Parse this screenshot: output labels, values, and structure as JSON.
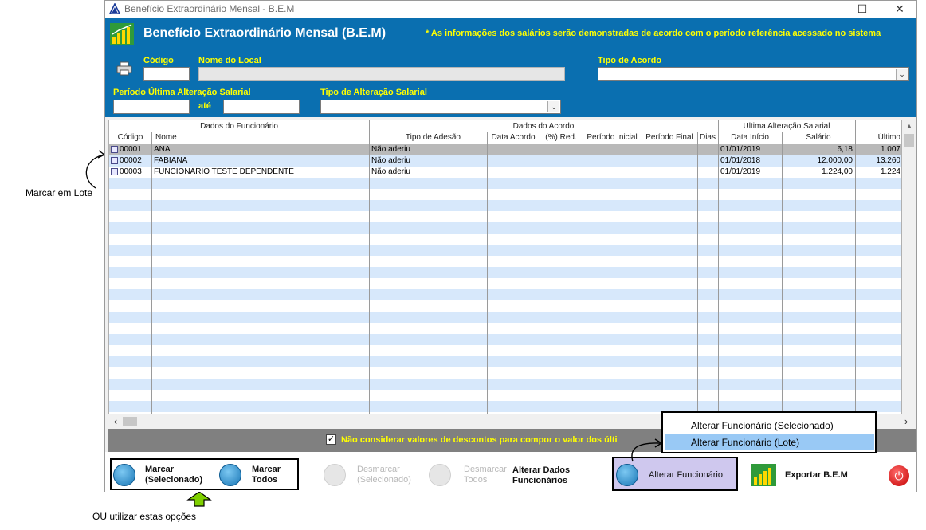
{
  "window": {
    "title": "Benefício Extraordinário Mensal - B.E.M",
    "minimize": "—",
    "maximize": "☐",
    "close": "✕"
  },
  "banner": {
    "title": "Benefício Extraordinário Mensal (B.E.M)",
    "note": "* As informações dos salários serão demonstradas de acordo com o período referência acessado no sistema"
  },
  "filters": {
    "codigo_label": "Código",
    "nome_local_label": "Nome do Local",
    "tipo_acordo_label": "Tipo de Acordo",
    "periodo_label": "Período Última Alteração Salarial",
    "ate_label": "até",
    "tipo_alteracao_label": "Tipo de Alteração Salarial",
    "codigo_value": "",
    "nome_local_value": "",
    "tipo_acordo_value": "",
    "periodo_inicio_value": "",
    "periodo_fim_value": "",
    "tipo_alteracao_value": ""
  },
  "grid": {
    "groups": {
      "funcionario": "Dados do Funcionário",
      "acordo": "Dados do Acordo",
      "ultima": "Ultima Alteração Salarial"
    },
    "columns": [
      "Código",
      "Nome",
      "Tipo de Adesão",
      "Data Acordo",
      "(%) Red.",
      "Período Inicial",
      "Período Final",
      "Dias",
      "Data Início",
      "Salário",
      "Último"
    ],
    "rows": [
      {
        "codigo": "00001",
        "nome": "ANA",
        "adesao": "Não aderiu",
        "data_acordo": "",
        "red": "",
        "p_ini": "",
        "p_fim": "",
        "dias": "",
        "data_inicio": "01/01/2019",
        "salario": "6,18",
        "ultimo": "1.007"
      },
      {
        "codigo": "00002",
        "nome": "FABIANA",
        "adesao": "Não aderiu",
        "data_acordo": "",
        "red": "",
        "p_ini": "",
        "p_fim": "",
        "dias": "",
        "data_inicio": "01/01/2018",
        "salario": "12.000,00",
        "ultimo": "13.260"
      },
      {
        "codigo": "00003",
        "nome": "FUNCIONARIO TESTE DEPENDENTE",
        "adesao": "Não aderiu",
        "data_acordo": "",
        "red": "",
        "p_ini": "",
        "p_fim": "",
        "dias": "",
        "data_inicio": "01/01/2019",
        "salario": "1.224,00",
        "ultimo": "1.224"
      }
    ]
  },
  "option": {
    "checkbox_label": "Não considerar valores de descontos para compor o valor dos últi",
    "checked": true
  },
  "toolbar": {
    "marcar_sel": "Marcar (Selecionado)",
    "marcar_todos": "Marcar Todos",
    "desmarcar_sel": "Desmarcar (Selecionado)",
    "desmarcar_todos": "Desmarcar Todos",
    "alterar_dados": "Alterar Dados Funcionários",
    "alterar_func": "Alterar Funcionário",
    "exportar": "Exportar B.E.M"
  },
  "popup": {
    "item1": "Alterar Funcionário (Selecionado)",
    "item2": "Alterar Funcionário (Lote)"
  },
  "annotations": {
    "marcar_lote": "Marcar em Lote",
    "ou_utilizar": "OU utilizar estas opções"
  },
  "colors": {
    "banner": "#0a6fb0",
    "label_yellow": "#ffff00",
    "row_stripe": "#d7e8fb",
    "row_selected": "#b9b9b9",
    "popup_highlight": "#99c9f5",
    "arrow_green": "#7fd000"
  }
}
